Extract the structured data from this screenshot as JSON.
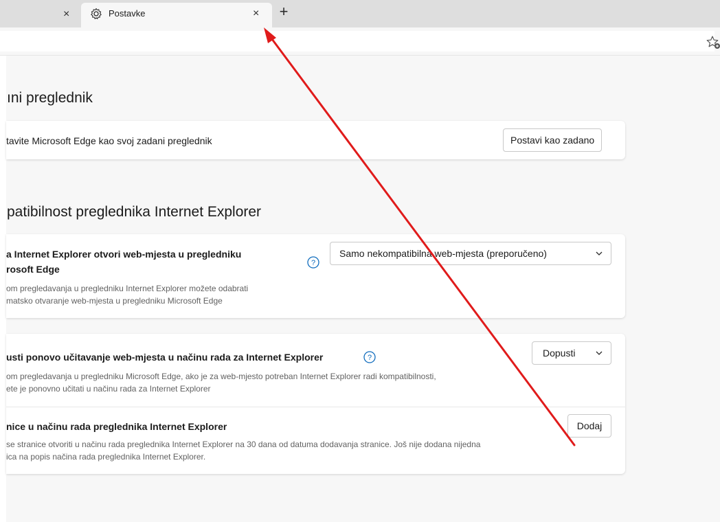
{
  "tabs": {
    "inactive_close": "×",
    "active_title": "Postavke",
    "active_close": "×",
    "new_tab": "+"
  },
  "default_browser": {
    "heading": "ıni preglednik",
    "row_text": "tavite Microsoft Edge kao svoj zadani preglednik",
    "button": "Postavi kao zadano"
  },
  "ie_compat": {
    "heading": "patibilnost preglednika Internet Explorer",
    "open_sites": {
      "title_line1": "a Internet Explorer otvori web-mjesta u pregledniku",
      "title_line2": "rosoft Edge",
      "desc_line1": "om pregledavanja u pregledniku Internet Explorer možete odabrati",
      "desc_line2": "matsko otvaranje web-mjesta u pregledniku Microsoft Edge",
      "select_value": "Samo nekompatibilna web-mjesta (preporučeno)"
    },
    "reload": {
      "title": "usti ponovo učitavanje web-mjesta u načinu rada za Internet Explorer",
      "desc_line1": "om pregledavanja u pregledniku Microsoft Edge, ako je za web-mjesto potreban Internet Explorer radi kompatibilnosti,",
      "desc_line2": "ete je ponovno učitati u načinu rada za Internet Explorer",
      "select_value": "Dopusti"
    },
    "pages": {
      "title": "nice u načinu rada preglednika Internet Explorer",
      "desc_line1": "se stranice otvoriti u načinu rada preglednika Internet Explorer na 30 dana od datuma dodavanja stranice. Još nije dodana nijedna",
      "desc_line2": "ica na popis načina rada preglednika Internet Explorer.",
      "button": "Dodaj"
    }
  },
  "colors": {
    "annotation_arrow": "#e01b1b"
  },
  "icons": [
    "close-icon",
    "gear-icon",
    "plus-icon",
    "favorite-icon",
    "help-icon",
    "chevron-down-icon"
  ]
}
